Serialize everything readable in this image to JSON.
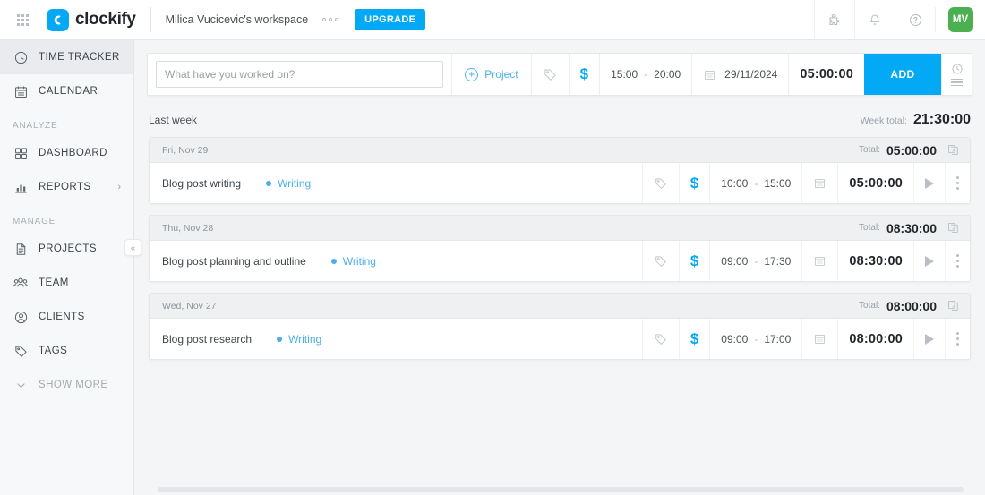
{
  "topbar": {
    "apps_icon": "apps-grid-icon",
    "logo_text": "clockify",
    "workspace": "Milica Vucicevic's workspace",
    "upgrade_label": "UPGRADE",
    "icons": [
      {
        "name": "integrations-icon"
      },
      {
        "name": "bell-icon"
      },
      {
        "name": "help-icon"
      }
    ],
    "avatar_initials": "MV",
    "avatar_color": "#4caf50",
    "accent_color": "#03a9f4"
  },
  "sidebar": {
    "items": [
      {
        "label": "TIME TRACKER",
        "icon": "clock-icon",
        "active": true
      },
      {
        "label": "CALENDAR",
        "icon": "calendar-icon",
        "active": false
      }
    ],
    "analyze_label": "ANALYZE",
    "analyze_items": [
      {
        "label": "DASHBOARD",
        "icon": "dashboard-icon",
        "chevron": ""
      },
      {
        "label": "REPORTS",
        "icon": "reports-icon",
        "chevron": "›"
      }
    ],
    "manage_label": "MANAGE",
    "manage_items": [
      {
        "label": "PROJECTS",
        "icon": "projects-icon"
      },
      {
        "label": "TEAM",
        "icon": "team-icon"
      },
      {
        "label": "CLIENTS",
        "icon": "clients-icon"
      },
      {
        "label": "TAGS",
        "icon": "tag-icon"
      }
    ],
    "show_more_label": "SHOW MORE",
    "show_more_icon": "chevron-down-icon",
    "collapse_icon": "«"
  },
  "tracker": {
    "placeholder": "What have you worked on?",
    "value": "",
    "project_label": "Project",
    "tag_icon": "tag-icon",
    "billable_icon": "dollar-icon",
    "start_time": "15:00",
    "time_separator": "-",
    "end_time": "20:00",
    "date": "29/11/2024",
    "duration": "05:00:00",
    "add_label": "ADD",
    "mode_timer_icon": "clock-icon",
    "mode_manual_icon": "list-icon"
  },
  "week": {
    "title": "Last week",
    "total_label": "Week total:",
    "total_value": "21:30:00"
  },
  "days": [
    {
      "day_label": "Fri, Nov 29",
      "total_label": "Total:",
      "total_value": "05:00:00",
      "entries": [
        {
          "description": "Blog post writing",
          "project": "Writing",
          "project_color": "#4aafe8",
          "start_time": "10:00",
          "time_separator": "-",
          "end_time": "15:00",
          "duration": "05:00:00"
        }
      ]
    },
    {
      "day_label": "Thu, Nov 28",
      "total_label": "Total:",
      "total_value": "08:30:00",
      "entries": [
        {
          "description": "Blog post planning and outline",
          "project": "Writing",
          "project_color": "#4aafe8",
          "start_time": "09:00",
          "time_separator": "-",
          "end_time": "17:30",
          "duration": "08:30:00"
        }
      ]
    },
    {
      "day_label": "Wed, Nov 27",
      "total_label": "Total:",
      "total_value": "08:00:00",
      "entries": [
        {
          "description": "Blog post research",
          "project": "Writing",
          "project_color": "#4aafe8",
          "start_time": "09:00",
          "time_separator": "-",
          "end_time": "17:00",
          "duration": "08:00:00"
        }
      ]
    }
  ]
}
